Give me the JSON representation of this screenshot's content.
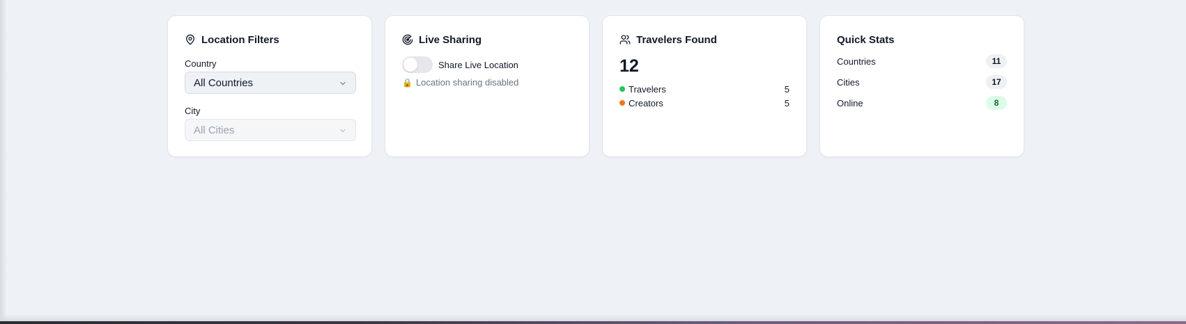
{
  "location_filters": {
    "title": "Location Filters",
    "country_label": "Country",
    "country_value": "All Countries",
    "city_label": "City",
    "city_value": "All Cities"
  },
  "live_sharing": {
    "title": "Live Sharing",
    "toggle_label": "Share Live Location",
    "toggle_on": false,
    "status_text": "Location sharing disabled"
  },
  "travelers_found": {
    "title": "Travelers Found",
    "total": "12",
    "rows": [
      {
        "label": "Travelers",
        "count": "5",
        "color": "#22c55e"
      },
      {
        "label": "Creators",
        "count": "5",
        "color": "#f97316"
      }
    ]
  },
  "quick_stats": {
    "title": "Quick Stats",
    "rows": [
      {
        "label": "Countries",
        "value": "11"
      },
      {
        "label": "Cities",
        "value": "17"
      },
      {
        "label": "Online",
        "value": "8"
      }
    ]
  }
}
